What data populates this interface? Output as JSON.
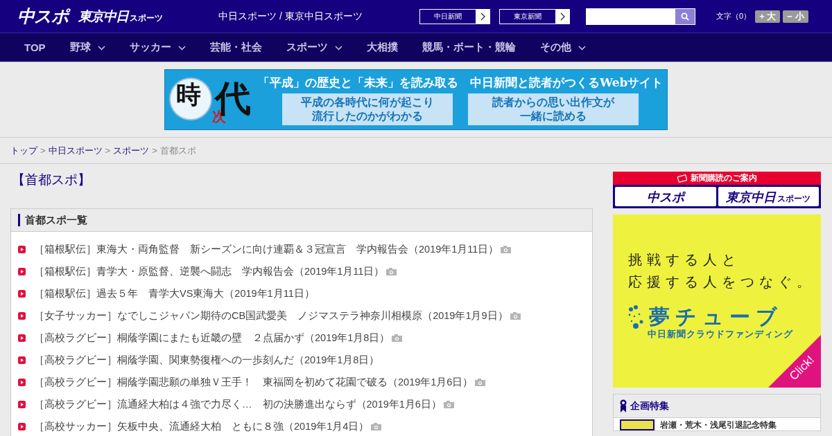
{
  "header": {
    "logo": "中スポ",
    "logo2": "東京中日",
    "logo2_sub": "スポーツ",
    "site_title": "中日スポーツ / 東京中日スポーツ",
    "links": [
      {
        "label": "中日新聞"
      },
      {
        "label": "東京新聞"
      }
    ],
    "font_size_label": "文字（0）",
    "font_buttons": [
      "+ 大",
      "− 小"
    ]
  },
  "nav": [
    {
      "label": "TOP",
      "dropdown": false
    },
    {
      "label": "野球",
      "dropdown": true
    },
    {
      "label": "サッカー",
      "dropdown": true
    },
    {
      "label": "芸能・社会",
      "dropdown": false
    },
    {
      "label": "スポーツ",
      "dropdown": true
    },
    {
      "label": "大相撲",
      "dropdown": false
    },
    {
      "label": "競馬・ボート・競輪",
      "dropdown": false
    },
    {
      "label": "その他",
      "dropdown": true
    }
  ],
  "banner": {
    "logo": [
      "時",
      "次",
      "代"
    ],
    "headline": "「平成」の歴史と「未来」を読み取る　中日新聞と読者がつくるWebサイト",
    "boxes": [
      [
        "平成の各時代に何が起こり",
        "流行したのかがわかる"
      ],
      [
        "読者からの思い出作文が",
        "一緒に読める"
      ]
    ]
  },
  "breadcrumb": {
    "separator": ">",
    "items": [
      {
        "label": "トップ",
        "link": true
      },
      {
        "label": "中日スポーツ",
        "link": true
      },
      {
        "label": "スポーツ",
        "link": true
      },
      {
        "label": "首都スポ",
        "link": false
      }
    ]
  },
  "page_title": "【首都スポ】",
  "list": {
    "title": "首都スポ一覧",
    "items": [
      {
        "text": "［箱根駅伝］東海大・両角監督　新シーズンに向け連覇＆３冠宣言　学内報告会（2019年1月11日）",
        "photo": true
      },
      {
        "text": "［箱根駅伝］青学大・原監督、逆襲へ闘志　学内報告会（2019年1月11日）",
        "photo": true
      },
      {
        "text": "［箱根駅伝］過去５年　青学大VS東海大（2019年1月11日）",
        "photo": false
      },
      {
        "text": "［女子サッカー］なでしこジャパン期待のCB国武愛美　ノジマステラ神奈川相模原（2019年1月9日）",
        "photo": true
      },
      {
        "text": "［高校ラグビー］桐蔭学園にまたも近畿の壁　２点届かず（2019年1月8日）",
        "photo": true
      },
      {
        "text": "［高校ラグビー］桐蔭学園、関東勢復権への一歩刻んだ（2019年1月8日）",
        "photo": false
      },
      {
        "text": "［高校ラグビー］桐蔭学園悲願の単独Ｖ王手！　東福岡を初めて花園で破る（2019年1月6日）",
        "photo": true
      },
      {
        "text": "［高校ラグビー］流通経大柏は４強で力尽く…　初の決勝進出ならず（2019年1月6日）",
        "photo": true
      },
      {
        "text": "［高校サッカー］矢板中央、流通経大柏　ともに８強（2019年1月4日）",
        "photo": true
      }
    ]
  },
  "sidebar": {
    "subscribe": {
      "title": "新聞購読のご案内",
      "buttons": [
        {
          "label": "中スポ"
        },
        {
          "label": "東京中日",
          "sub": "スポーツ"
        }
      ]
    },
    "ad": {
      "lines": [
        "挑戦する人と",
        "応援する人をつなぐ。"
      ],
      "brand": "夢チューブ",
      "tagline": "中日新聞クラウドファンディング",
      "corner": "Click!"
    },
    "features": {
      "title": "企画特集",
      "items": [
        {
          "label": "岩瀬・荒木・浅尾引退記念特集"
        }
      ]
    }
  }
}
